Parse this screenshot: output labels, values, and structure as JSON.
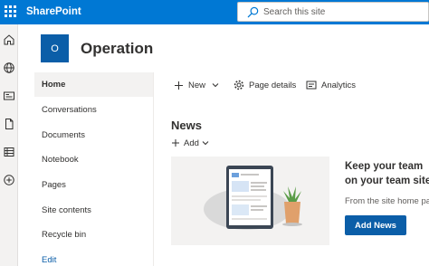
{
  "suite_bar": {
    "brand": "SharePoint",
    "search_placeholder": "Search this site",
    "accent": "#0078d4"
  },
  "app_bar": {
    "icons": [
      "home-icon",
      "globe-icon",
      "news-icon",
      "file-icon",
      "list-icon",
      "add-circle-icon"
    ]
  },
  "site": {
    "logo_letter": "O",
    "title": "Operation",
    "logo_color": "#0b5ea8"
  },
  "left_nav": {
    "items": [
      {
        "label": "Home",
        "selected": true
      },
      {
        "label": "Conversations"
      },
      {
        "label": "Documents"
      },
      {
        "label": "Notebook"
      },
      {
        "label": "Pages"
      },
      {
        "label": "Site contents"
      },
      {
        "label": "Recycle bin"
      },
      {
        "label": "Edit",
        "link": true
      }
    ]
  },
  "command_bar": {
    "new_label": "New",
    "page_details_label": "Page details",
    "analytics_label": "Analytics"
  },
  "news": {
    "title": "News",
    "add_label": "Add",
    "heading_line1": "Keep your team",
    "heading_line2": "on your team site",
    "body": "From the site home page",
    "button_label": "Add News"
  }
}
